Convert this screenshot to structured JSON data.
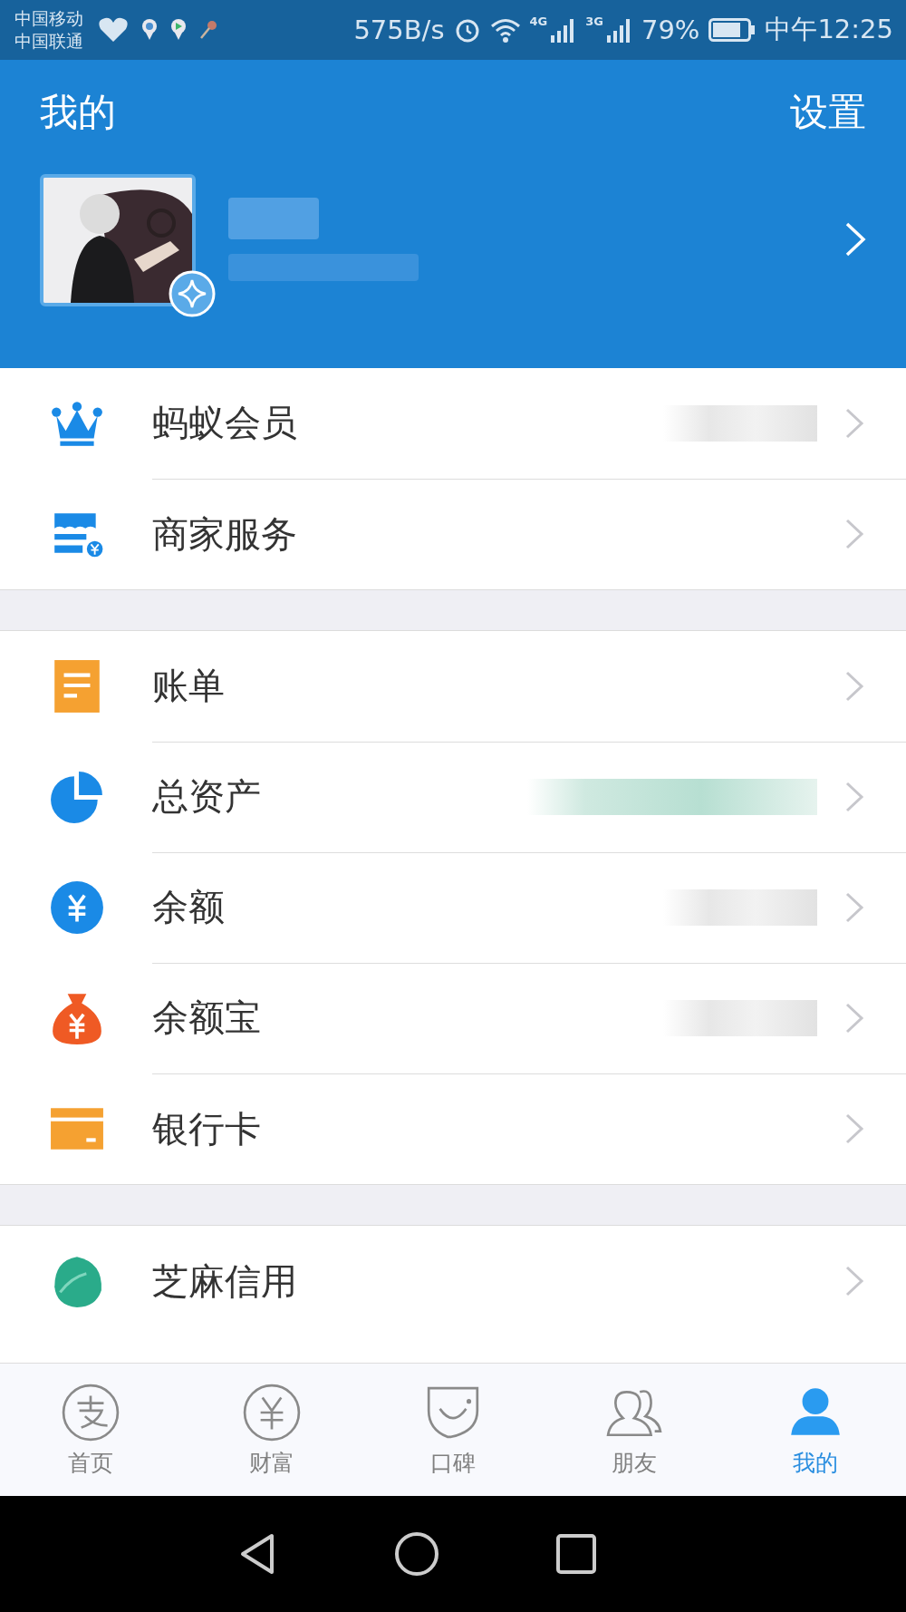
{
  "status_bar": {
    "carriers": [
      "中国移动",
      "中国联通"
    ],
    "speed": "575B/s",
    "network_1": "4G",
    "network_2": "3G",
    "battery": "79%",
    "time": "中午12:25"
  },
  "header": {
    "title": "我的",
    "settings": "设置"
  },
  "sections": [
    [
      {
        "kind": "crown",
        "label": "蚂蚁会员",
        "masked": true
      },
      {
        "kind": "shop",
        "label": "商家服务",
        "masked": false
      }
    ],
    [
      {
        "kind": "bill",
        "label": "账单",
        "masked": false
      },
      {
        "kind": "pie",
        "label": "总资产",
        "masked": true
      },
      {
        "kind": "yuan",
        "label": "余额",
        "masked": true
      },
      {
        "kind": "bag",
        "label": "余额宝",
        "masked": true
      },
      {
        "kind": "card",
        "label": "银行卡",
        "masked": false
      }
    ],
    [
      {
        "kind": "sesame",
        "label": "芝麻信用",
        "masked": false
      }
    ]
  ],
  "tabs": [
    {
      "kind": "home",
      "label": "首页",
      "selected": false
    },
    {
      "kind": "wealth",
      "label": "财富",
      "selected": false
    },
    {
      "kind": "koubei",
      "label": "口碑",
      "selected": false
    },
    {
      "kind": "friends",
      "label": "朋友",
      "selected": false
    },
    {
      "kind": "me",
      "label": "我的",
      "selected": true
    }
  ]
}
